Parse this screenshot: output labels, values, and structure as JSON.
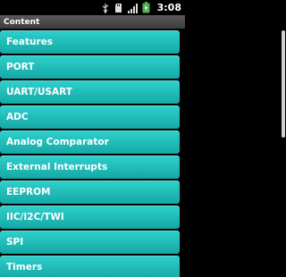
{
  "status_bar": {
    "time": "3:08",
    "icons": [
      "usb-icon",
      "sd-card-icon",
      "signal-icon",
      "battery-charging-icon"
    ]
  },
  "title_bar": {
    "title": "Content"
  },
  "list": {
    "items": [
      {
        "label": "Features"
      },
      {
        "label": "PORT"
      },
      {
        "label": "UART/USART"
      },
      {
        "label": "ADC"
      },
      {
        "label": "Analog Comparator"
      },
      {
        "label": "External Interrupts"
      },
      {
        "label": "EEPROM"
      },
      {
        "label": "IIC/I2C/TWI"
      },
      {
        "label": "SPI"
      },
      {
        "label": "Timers"
      }
    ]
  },
  "colors": {
    "item_top": "#2fd1cc",
    "item_bottom": "#14a8a6",
    "battery": "#4caf50",
    "background": "#000000"
  }
}
